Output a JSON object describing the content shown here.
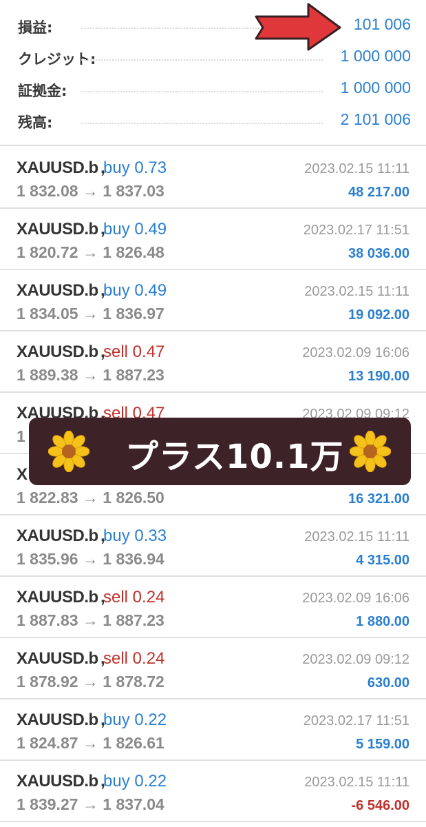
{
  "summary": [
    {
      "label": "損益:",
      "value": "101 006"
    },
    {
      "label": "クレジット:",
      "value": "1 000 000"
    },
    {
      "label": "証拠金:",
      "value": "1 000 000"
    },
    {
      "label": "残高:",
      "value": "2 101 006"
    }
  ],
  "trades": [
    {
      "symbol": "XAUUSD.b",
      "direction": "buy 0.73",
      "prices": "1 832.08 → 1 837.03",
      "time": "2023.02.15 11:11",
      "profit": "48 217.00"
    },
    {
      "symbol": "XAUUSD.b",
      "direction": "buy 0.49",
      "prices": "1 820.72 → 1 826.48",
      "time": "2023.02.17 11:51",
      "profit": "38 036.00"
    },
    {
      "symbol": "XAUUSD.b",
      "direction": "buy 0.49",
      "prices": "1 834.05 → 1 836.97",
      "time": "2023.02.15 11:11",
      "profit": "19 092.00"
    },
    {
      "symbol": "XAUUSD.b",
      "direction": "sell 0.47",
      "prices": "1 889.38 → 1 887.23",
      "time": "2023.02.09 16:06",
      "profit": "13 190.00"
    },
    {
      "symbol": "XAUUSD.b",
      "direction": "sell 0.47",
      "prices": "1",
      "time": "2023.02.09 09:12",
      "profit": ""
    },
    {
      "symbol": "X",
      "direction": "",
      "prices": "1 822.83 → 1 826.50",
      "time": "",
      "profit": "16 321.00"
    },
    {
      "symbol": "XAUUSD.b",
      "direction": "buy 0.33",
      "prices": "1 835.96 → 1 836.94",
      "time": "2023.02.15 11:11",
      "profit": "4 315.00"
    },
    {
      "symbol": "XAUUSD.b",
      "direction": "sell 0.24",
      "prices": "1 887.83 → 1 887.23",
      "time": "2023.02.09 16:06",
      "profit": "1 880.00"
    },
    {
      "symbol": "XAUUSD.b",
      "direction": "sell 0.24",
      "prices": "1 878.92 → 1 878.72",
      "time": "2023.02.09 09:12",
      "profit": "630.00"
    },
    {
      "symbol": "XAUUSD.b",
      "direction": "buy 0.22",
      "prices": "1 824.87 → 1 826.61",
      "time": "2023.02.17 11:51",
      "profit": "5 159.00"
    },
    {
      "symbol": "XAUUSD.b",
      "direction": "buy 0.22",
      "prices": "1 839.27 → 1 837.04",
      "time": "2023.02.15 11:11",
      "profit": "-6 546.00"
    }
  ],
  "banner": {
    "text": "プラス10.1万",
    "left_icon": "sunflower-icon",
    "right_icon": "sunflower-icon"
  },
  "colors": {
    "profit_blue": "#2a7fd0",
    "loss_red": "#c0302a",
    "banner_bg": "#3d2327",
    "arrow_red": "#e0383a"
  }
}
